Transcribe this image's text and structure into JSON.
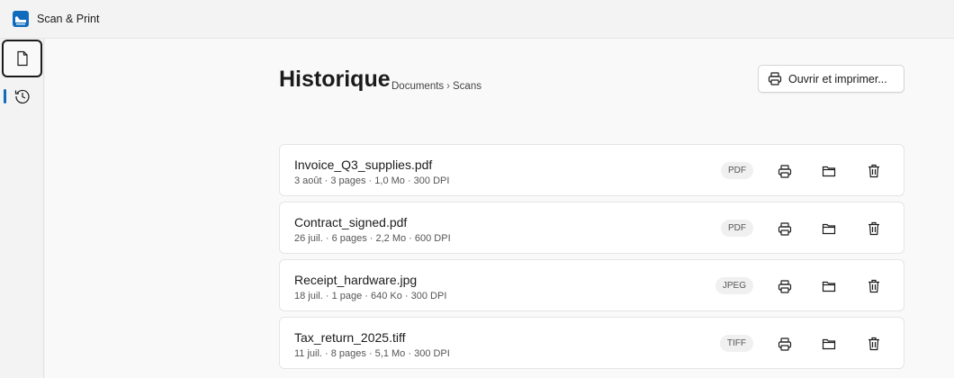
{
  "app": {
    "title": "Scan & Print",
    "accent": "#0f6cbd"
  },
  "nav": {
    "items": [
      {
        "icon": "document-icon",
        "selected": true
      },
      {
        "icon": "history-icon",
        "selected": false
      }
    ]
  },
  "header": {
    "title": "Historique",
    "breadcrumb": [
      "Documents",
      "Scans"
    ],
    "breadcrumb_separator": "›",
    "open_print_label": "Ouvrir et imprimer..."
  },
  "files": [
    {
      "name": "Invoice_Q3_supplies.pdf",
      "meta": "3 août · 3 pages · 1,0 Mo · 300 DPI",
      "type": "PDF"
    },
    {
      "name": "Contract_signed.pdf",
      "meta": "26 juil. · 6 pages · 2,2 Mo · 600 DPI",
      "type": "PDF"
    },
    {
      "name": "Receipt_hardware.jpg",
      "meta": "18 juil. · 1 page · 640 Ko · 300 DPI",
      "type": "JPEG"
    },
    {
      "name": "Tax_return_2025.tiff",
      "meta": "11 juil. · 8 pages · 5,1 Mo · 300 DPI",
      "type": "TIFF"
    }
  ],
  "row_actions": [
    "printer-icon",
    "folder-icon",
    "trash-icon"
  ]
}
